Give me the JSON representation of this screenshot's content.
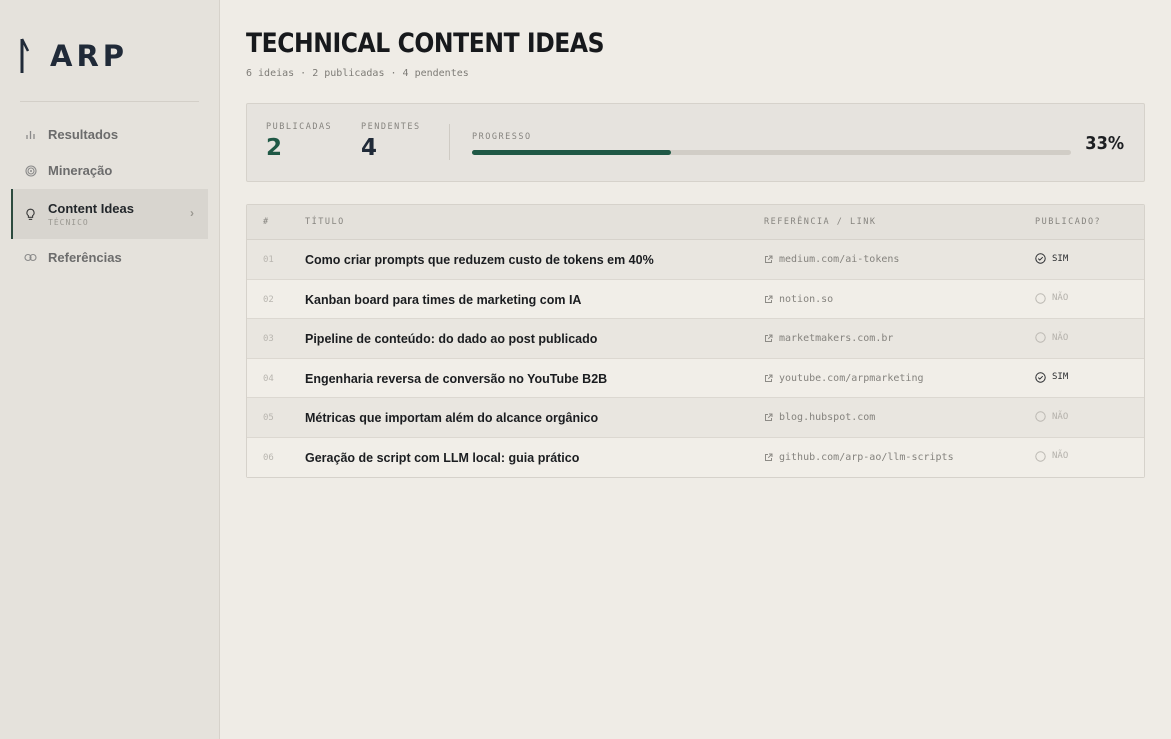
{
  "app": {
    "logo_text": "ARP"
  },
  "sidebar": {
    "items": [
      {
        "label": "Resultados",
        "icon": "bar-chart-icon",
        "active": false
      },
      {
        "label": "Mineração",
        "icon": "target-icon",
        "active": false
      },
      {
        "label": "Content Ideas",
        "sublabel": "TÉCNICO",
        "icon": "lightbulb-icon",
        "active": true
      },
      {
        "label": "Referências",
        "icon": "link-icon",
        "active": false
      }
    ]
  },
  "header": {
    "title": "TECHNICAL CONTENT IDEAS",
    "subtitle": "6 ideias · 2 publicadas · 4 pendentes"
  },
  "stats": {
    "published_label": "PUBLICADAS",
    "published_value": "2",
    "pending_label": "PENDENTES",
    "pending_value": "4",
    "progress_label": "PROGRESSO",
    "progress_text": "33%",
    "progress_fraction": 0.333
  },
  "table": {
    "headers": {
      "num": "#",
      "title": "TÍTULO",
      "ref": "REFERÊNCIA / LINK",
      "pub": "PUBLICADO?"
    },
    "rows": [
      {
        "num": "01",
        "title": "Como criar prompts que reduzem custo de tokens em 40%",
        "ref": "medium.com/ai-tokens",
        "pub": "SIM",
        "published": true
      },
      {
        "num": "02",
        "title": "Kanban board para times de marketing com IA",
        "ref": "notion.so",
        "pub": "NÃO",
        "published": false
      },
      {
        "num": "03",
        "title": "Pipeline de conteúdo: do dado ao post publicado",
        "ref": "marketmakers.com.br",
        "pub": "NÃO",
        "published": false
      },
      {
        "num": "04",
        "title": "Engenharia reversa de conversão no YouTube B2B",
        "ref": "youtube.com/arpmarketing",
        "pub": "SIM",
        "published": true
      },
      {
        "num": "05",
        "title": "Métricas que importam além do alcance orgânico",
        "ref": "blog.hubspot.com",
        "pub": "NÃO",
        "published": false
      },
      {
        "num": "06",
        "title": "Geração de script com LLM local: guia prático",
        "ref": "github.com/arp-ao/llm-scripts",
        "pub": "NÃO",
        "published": false
      }
    ]
  },
  "colors": {
    "accent": "#1f5845",
    "published_value": "#1f5845",
    "pending_value": "#202a38",
    "sidebar_bg": "#e5e2dc",
    "page_bg": "#efece6"
  }
}
